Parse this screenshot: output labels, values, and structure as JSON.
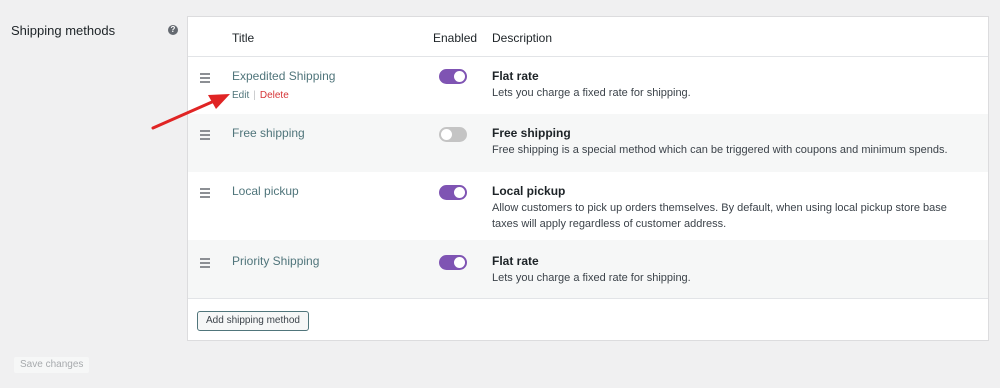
{
  "section": {
    "label": "Shipping methods",
    "help_icon": "question-circle-icon"
  },
  "table": {
    "headers": {
      "title": "Title",
      "enabled": "Enabled",
      "description": "Description"
    },
    "rows": [
      {
        "title": "Expedited Shipping",
        "enabled": true,
        "desc_title": "Flat rate",
        "desc_text": "Lets you charge a fixed rate for shipping.",
        "edit": "Edit",
        "delete": "Delete"
      },
      {
        "title": "Free shipping",
        "enabled": false,
        "desc_title": "Free shipping",
        "desc_text": "Free shipping is a special method which can be triggered with coupons and minimum spends."
      },
      {
        "title": "Local pickup",
        "enabled": true,
        "desc_title": "Local pickup",
        "desc_text": "Allow customers to pick up orders themselves. By default, when using local pickup store base taxes will apply regardless of customer address."
      },
      {
        "title": "Priority Shipping",
        "enabled": true,
        "desc_title": "Flat rate",
        "desc_text": "Lets you charge a fixed rate for shipping."
      }
    ]
  },
  "buttons": {
    "add_method": "Add shipping method",
    "save_changes": "Save changes"
  },
  "colors": {
    "toggle_on": "#7f54b3",
    "toggle_off": "#c4c4c4",
    "link": "#50757b",
    "delete": "#d63638",
    "annotation_arrow": "#e02424"
  }
}
